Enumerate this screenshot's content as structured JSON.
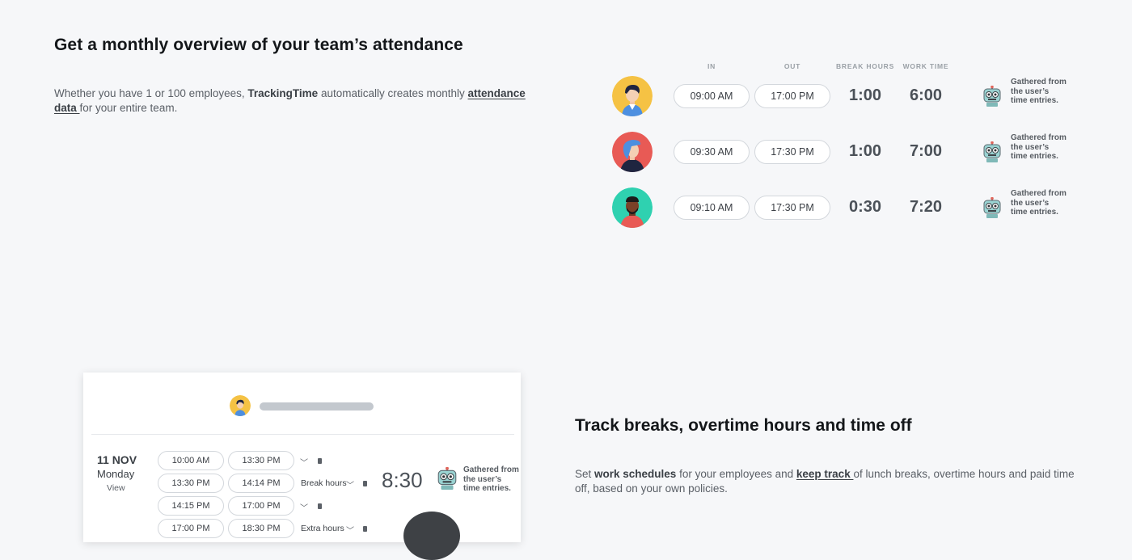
{
  "section1": {
    "title": "Get a monthly overview of your team’s attendance",
    "desc_pre": "Whether you have 1 or 100 employees, ",
    "brand": "TrackingTime",
    "desc_mid": " automatically creates monthly ",
    "link": "attendance data ",
    "desc_post": "for your entire team.",
    "columns": {
      "in": "IN",
      "out": "OUT",
      "break": "BREAK HOURS",
      "work": "WORK TIME"
    },
    "rows": [
      {
        "in": "09:00 AM",
        "out": "17:00 PM",
        "break": "1:00",
        "work": "6:00",
        "note": "Gathered from the user’s time entries."
      },
      {
        "in": "09:30 AM",
        "out": "17:30 PM",
        "break": "1:00",
        "work": "7:00",
        "note": "Gathered from the user’s time entries."
      },
      {
        "in": "09:10 AM",
        "out": "17:30 PM",
        "break": "0:30",
        "work": "7:20",
        "note": "Gathered from the user’s time entries."
      }
    ]
  },
  "card": {
    "date": "11 NOV",
    "day": "Monday",
    "view": "View",
    "entries": [
      {
        "start": "10:00 AM",
        "end": "13:30 PM",
        "label": ""
      },
      {
        "start": "13:30 PM",
        "end": "14:14 PM",
        "label": "Break hours"
      },
      {
        "start": "14:15 PM",
        "end": "17:00 PM",
        "label": ""
      },
      {
        "start": "17:00 PM",
        "end": "18:30 PM",
        "label": "Extra hours"
      }
    ],
    "total": "8:30",
    "note": "Gathered from the user’s time entries."
  },
  "section2": {
    "title": "Track breaks, overtime hours and time off",
    "desc_pre": "Set ",
    "bold1": "work schedules",
    "desc_mid": " for your employees and ",
    "link": "keep track ",
    "desc_post": "of lunch breaks, overtime hours and paid time off, based on your own policies."
  }
}
